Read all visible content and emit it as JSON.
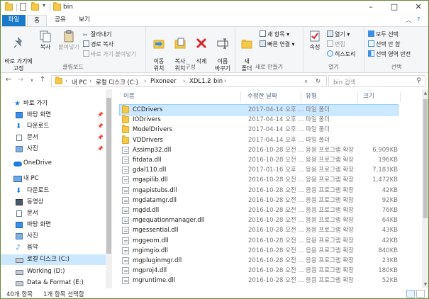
{
  "window": {
    "title": "bin"
  },
  "ribbon_tabs": {
    "file": "파일",
    "home": "홈",
    "share": "공유",
    "view": "보기"
  },
  "ribbon": {
    "clipboard": {
      "pin": "바로 가기에\n고정",
      "copy": "복사",
      "paste": "붙여넣기",
      "cut": "잘라내기",
      "copy_path": "경로 복사",
      "paste_shortcut": "바로 가기 붙여넣기",
      "label": "클립보드"
    },
    "organize": {
      "move": "이동\n위치",
      "copyto": "복사\n위치",
      "delete": "삭제",
      "rename": "이름\n바꾸기",
      "label": "구성"
    },
    "new": {
      "folder": "새\n폴더",
      "new_item": "새 항목",
      "easy_access": "빠른 연결",
      "label": "새로 만들기"
    },
    "open": {
      "properties": "속성",
      "open": "열기",
      "edit": "편집",
      "history": "히스토리",
      "label": "열기"
    },
    "select": {
      "all": "모두 선택",
      "none": "선택 안 함",
      "invert": "선택 영역 반전",
      "label": "선택"
    }
  },
  "address": {
    "segments": [
      "내 PC",
      "로컬 디스크 (C:)",
      "Pixoneer",
      "XDL1.2",
      "bin"
    ]
  },
  "search": {
    "placeholder": "bin 검색"
  },
  "nav": {
    "items": [
      {
        "label": "바로 가기",
        "icon": "star-icon"
      },
      {
        "label": "바탕 화면",
        "icon": "desktop-icon",
        "pinned": true
      },
      {
        "label": "다운로드",
        "icon": "download-icon",
        "pinned": true
      },
      {
        "label": "문서",
        "icon": "document-icon",
        "pinned": true
      },
      {
        "label": "사진",
        "icon": "picture-icon",
        "pinned": true
      },
      {
        "label": "OneDrive",
        "icon": "cloud-icon"
      },
      {
        "label": "내 PC",
        "icon": "pc-icon"
      },
      {
        "label": "다운로드",
        "icon": "download-icon"
      },
      {
        "label": "동영상",
        "icon": "video-icon"
      },
      {
        "label": "문서",
        "icon": "document-icon"
      },
      {
        "label": "바탕 화면",
        "icon": "desktop-icon"
      },
      {
        "label": "사진",
        "icon": "picture-icon"
      },
      {
        "label": "음악",
        "icon": "music-icon"
      },
      {
        "label": "로컬 디스크 (C:)",
        "icon": "drive-icon"
      },
      {
        "label": "Working (D:)",
        "icon": "drive-icon"
      },
      {
        "label": "Data & Format (E:)",
        "icon": "drive-icon"
      }
    ]
  },
  "columns": {
    "name": "이름",
    "date": "수정한 날짜",
    "type": "유형",
    "size": "크기"
  },
  "files": [
    {
      "name": "CCDrivers",
      "date": "2017-04-14 오후 ...",
      "type": "파일 폴더",
      "size": "",
      "kind": "folder"
    },
    {
      "name": "IODrivers",
      "date": "2017-04-14 오후 ...",
      "type": "파일 폴더",
      "size": "",
      "kind": "folder"
    },
    {
      "name": "ModelDrivers",
      "date": "2017-04-14 오후 ...",
      "type": "파일 폴더",
      "size": "",
      "kind": "folder"
    },
    {
      "name": "VDDrivers",
      "date": "2017-04-14 오후 ...",
      "type": "파일 폴더",
      "size": "",
      "kind": "folder"
    },
    {
      "name": "Assimp32.dll",
      "date": "2016-10-28 오전 ...",
      "type": "응용 프로그램 확장",
      "size": "6,909KB",
      "kind": "dll"
    },
    {
      "name": "fitdata.dll",
      "date": "2016-10-28 오전 ...",
      "type": "응용 프로그램 확장",
      "size": "196KB",
      "kind": "dll"
    },
    {
      "name": "gdal110.dll",
      "date": "2017-01-16 오후 ...",
      "type": "응용 프로그램 확장",
      "size": "7,183KB",
      "kind": "dll"
    },
    {
      "name": "mgapilib.dll",
      "date": "2016-10-28 오전 ...",
      "type": "응용 프로그램 확장",
      "size": "1,472KB",
      "kind": "dll"
    },
    {
      "name": "mgapistubs.dll",
      "date": "2016-10-28 오전 ...",
      "type": "응용 프로그램 확장",
      "size": "42KB",
      "kind": "dll"
    },
    {
      "name": "mgdatamgr.dll",
      "date": "2016-10-28 오전 ...",
      "type": "응용 프로그램 확장",
      "size": "92KB",
      "kind": "dll"
    },
    {
      "name": "mgdd.dll",
      "date": "2016-10-28 오전 ...",
      "type": "응용 프로그램 확장",
      "size": "76KB",
      "kind": "dll"
    },
    {
      "name": "mgequationmanager.dll",
      "date": "2016-10-28 오전 ...",
      "type": "응용 프로그램 확장",
      "size": "64KB",
      "kind": "dll"
    },
    {
      "name": "mgessential.dll",
      "date": "2016-10-28 오전 ...",
      "type": "응용 프로그램 확장",
      "size": "43KB",
      "kind": "dll"
    },
    {
      "name": "mggeom.dll",
      "date": "2016-10-28 오전 ...",
      "type": "응용 프로그램 확장",
      "size": "42KB",
      "kind": "dll"
    },
    {
      "name": "mgimgio.dll",
      "date": "2016-10-28 오전 ...",
      "type": "응용 프로그램 확장",
      "size": "840KB",
      "kind": "dll"
    },
    {
      "name": "mgpluginmgr.dll",
      "date": "2016-10-28 오전 ...",
      "type": "응용 프로그램 확장",
      "size": "23KB",
      "kind": "dll"
    },
    {
      "name": "mgproj4.dll",
      "date": "2016-10-28 오전 ...",
      "type": "응용 프로그램 확장",
      "size": "180KB",
      "kind": "dll"
    },
    {
      "name": "mgruntime.dll",
      "date": "2016-10-28 오전 ...",
      "type": "응용 프로그램 확장",
      "size": "52KB",
      "kind": "dll"
    }
  ],
  "status": {
    "count": "40개 항목",
    "selected": "1개 항목 선택함"
  }
}
